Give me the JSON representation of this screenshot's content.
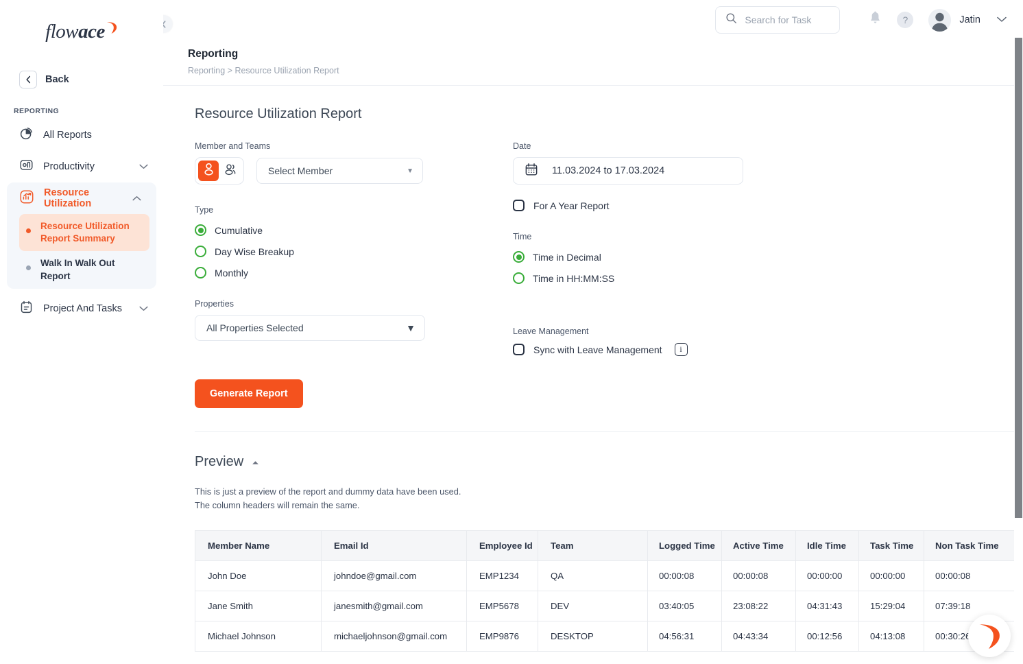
{
  "brand": {
    "logo_text_light": "flow",
    "logo_text_bold": "ace",
    "accent_color": "#f4521e"
  },
  "sidebar": {
    "back_label": "Back",
    "section_label": "REPORTING",
    "items": [
      {
        "label": "All Reports",
        "icon": "pie-chart-icon",
        "expandable": false
      },
      {
        "label": "Productivity",
        "icon": "bar-chart-icon",
        "expandable": true
      },
      {
        "label": "Resource Utilization",
        "icon": "trending-up-icon",
        "expandable": true,
        "active": true
      },
      {
        "label": "Project And Tasks",
        "icon": "clipboard-icon",
        "expandable": true
      }
    ],
    "sub_items": [
      {
        "label": "Resource Utilization Report Summary",
        "selected": true
      },
      {
        "label": "Walk In Walk Out Report",
        "selected": false
      }
    ]
  },
  "topbar": {
    "search_placeholder": "Search for Task",
    "search_value": "",
    "user_name": "Jatin",
    "help_glyph": "?"
  },
  "header": {
    "title": "Reporting",
    "breadcrumb": "Reporting > Resource Utilization Report"
  },
  "report": {
    "title": "Resource Utilization Report",
    "member_and_teams_label": "Member and Teams",
    "member_select_value": "Select Member",
    "type_label": "Type",
    "type_options": [
      {
        "label": "Cumulative",
        "checked": true
      },
      {
        "label": "Day Wise Breakup",
        "checked": false
      },
      {
        "label": "Monthly",
        "checked": false
      }
    ],
    "properties_label": "Properties",
    "properties_value": "All Properties Selected",
    "date_label": "Date",
    "date_value": "11.03.2024 to 17.03.2024",
    "for_a_year_label": "For A Year Report",
    "for_a_year_checked": false,
    "time_label": "Time",
    "time_options": [
      {
        "label": "Time in Decimal",
        "checked": true
      },
      {
        "label": "Time in HH:MM:SS",
        "checked": false
      }
    ],
    "leave_management_label": "Leave Management",
    "sync_leave_label": "Sync with Leave Management",
    "sync_leave_checked": false,
    "info_glyph": "i",
    "generate_button": "Generate Report"
  },
  "preview": {
    "title": "Preview",
    "note_line1": "This is just a preview of the report and dummy data have been used.",
    "note_line2": "The column headers will remain the same.",
    "columns": [
      "Member Name",
      "Email Id",
      "Employee Id",
      "Team",
      "Logged Time",
      "Active Time",
      "Idle Time",
      "Task Time",
      "Non Task Time"
    ],
    "rows": [
      {
        "member_name": "John Doe",
        "email": "johndoe@gmail.com",
        "employee_id": "EMP1234",
        "team": "QA",
        "logged_time": "00:00:08",
        "active_time": "00:00:08",
        "idle_time": "00:00:00",
        "task_time": "00:00:00",
        "non_task_time": "00:00:08"
      },
      {
        "member_name": "Jane Smith",
        "email": "janesmith@gmail.com",
        "employee_id": "EMP5678",
        "team": "DEV",
        "logged_time": "03:40:05",
        "active_time": "23:08:22",
        "idle_time": "04:31:43",
        "task_time": "15:29:04",
        "non_task_time": "07:39:18"
      },
      {
        "member_name": "Michael Johnson",
        "email": "michaeljohnson@gmail.com",
        "employee_id": "EMP9876",
        "team": "DESKTOP",
        "logged_time": "04:56:31",
        "active_time": "04:43:34",
        "idle_time": "00:12:56",
        "task_time": "04:13:08",
        "non_task_time": "00:30:26"
      }
    ]
  }
}
